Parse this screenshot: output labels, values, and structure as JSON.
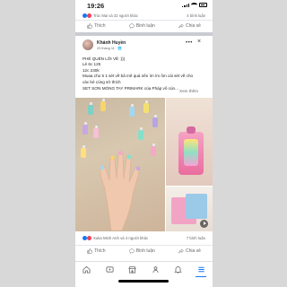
{
  "status_bar": {
    "time": "19:26"
  },
  "prev_post": {
    "reactions_text": "Trúc Mai và 32 người khác",
    "comments_text": "4 bình luận",
    "actions": {
      "like": "Thích",
      "comment": "Bình luận",
      "share": "Chia sẻ"
    }
  },
  "post": {
    "author": "Khánh Huyền",
    "meta": "20 tháng 11 · 🌐",
    "lines": [
      "PHẺ QUÉN LÕI VÊ :)))",
      "Lẻ 6c 125",
      "12c 230k",
      "Muaa cho 5 1 sét về bả mê quá nên ìm ìm ôm cái sét về cho",
      "các bé cùng sở thích"
    ],
    "link_line": "SET SƠN MÓNG TAY PRIMARK của Pháp vô cùn...",
    "see_more": "Xem thêm",
    "reactions_text": "Xuka Minh Anh và 4 người khác",
    "comments_text": "7 bình luận",
    "actions": {
      "like": "Thích",
      "comment": "Bình luận",
      "share": "Chia sẻ"
    }
  },
  "nav": [
    "home-icon",
    "watch-icon",
    "marketplace-icon",
    "groups-icon",
    "notifications-icon",
    "menu-icon"
  ],
  "colors": {
    "brand": "#1877f2",
    "like": "#1877f2",
    "love": "#f33e58",
    "text_secondary": "#65676b"
  }
}
